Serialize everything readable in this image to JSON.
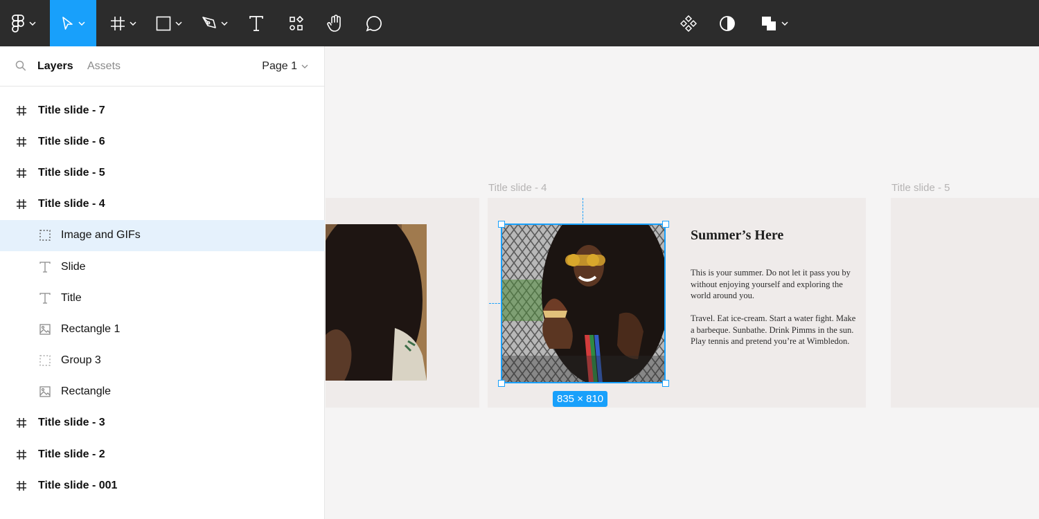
{
  "toolbar": {
    "tools": [
      "figma-menu",
      "move",
      "frame",
      "shape",
      "pen",
      "text",
      "resources",
      "hand",
      "comment"
    ],
    "right_tools": [
      "components",
      "theme",
      "boolean"
    ],
    "accent": "#18a0fb",
    "background": "#2c2c2c"
  },
  "panel": {
    "tabs": {
      "layers": "Layers",
      "assets": "Assets"
    },
    "page": "Page 1",
    "layers": [
      {
        "label": "Title slide - 7",
        "icon": "frame-icon",
        "level": 0
      },
      {
        "label": "Title slide - 6",
        "icon": "frame-icon",
        "level": 0
      },
      {
        "label": "Title slide - 5",
        "icon": "frame-icon",
        "level": 0
      },
      {
        "label": "Title slide - 4",
        "icon": "frame-icon",
        "level": 0
      },
      {
        "label": "Image and GIFs",
        "icon": "group-icon",
        "level": 1,
        "selected": true
      },
      {
        "label": "Slide",
        "icon": "text-icon",
        "level": 1
      },
      {
        "label": "Title",
        "icon": "text-icon",
        "level": 1
      },
      {
        "label": "Rectangle 1",
        "icon": "image-icon",
        "level": 1
      },
      {
        "label": "Group 3",
        "icon": "group-icon",
        "level": 1
      },
      {
        "label": "Rectangle",
        "icon": "image-icon",
        "level": 1
      },
      {
        "label": "Title slide - 3",
        "icon": "frame-icon",
        "level": 0
      },
      {
        "label": "Title slide - 2",
        "icon": "frame-icon",
        "level": 0
      },
      {
        "label": "Title slide - 001",
        "icon": "frame-icon",
        "level": 0
      }
    ]
  },
  "canvas": {
    "frame4_label": "Title slide - 4",
    "frame5_label": "Title slide - 5",
    "slide": {
      "title": "Summer’s Here",
      "body1": "This is your summer. Do not let it pass you by without enjoying yourself and exploring the world around you.",
      "body2": "Travel. Eat ice-cream. Start a water fight. Make a barbeque. Sunbathe. Drink Pimms in the sun. Play tennis and pretend you’re at Wimbledon."
    },
    "selection_size": "835 × 810"
  }
}
